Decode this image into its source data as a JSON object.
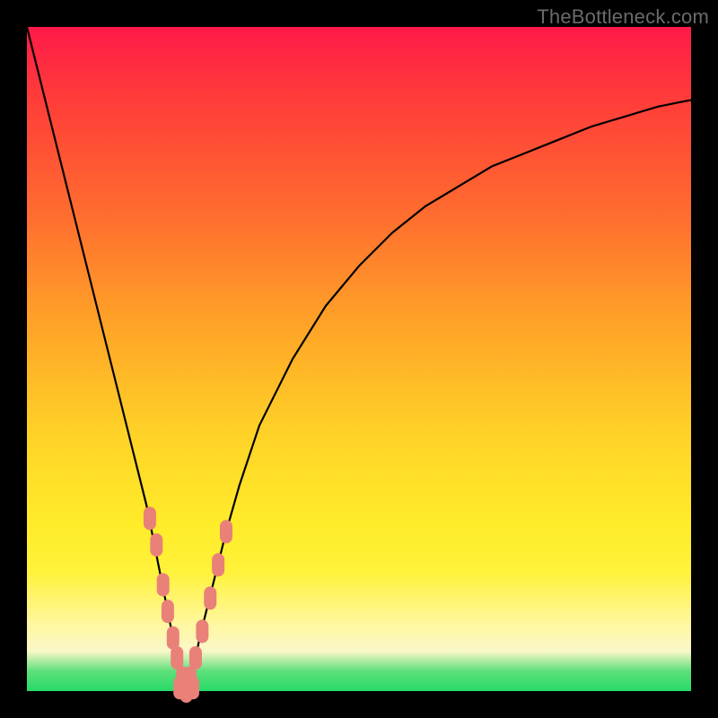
{
  "watermark": "TheBottleneck.com",
  "colors": {
    "frame": "#000000",
    "curve": "#000000",
    "marker": "#e98179",
    "gradient_top": "#ff1a49",
    "gradient_bottom": "#27da68"
  },
  "chart_data": {
    "type": "line",
    "title": "",
    "xlabel": "",
    "ylabel": "",
    "xlim": [
      0,
      100
    ],
    "ylim": [
      0,
      100
    ],
    "x": [
      0,
      2,
      4,
      6,
      8,
      10,
      12,
      14,
      16,
      18,
      20,
      22,
      23,
      24,
      25,
      26,
      28,
      30,
      32,
      35,
      40,
      45,
      50,
      55,
      60,
      65,
      70,
      75,
      80,
      85,
      90,
      95,
      100
    ],
    "y": [
      100,
      92,
      84,
      76,
      68,
      60,
      52,
      44,
      36,
      28,
      18,
      8,
      3,
      0,
      3,
      8,
      16,
      24,
      31,
      40,
      50,
      58,
      64,
      69,
      73,
      76,
      79,
      81,
      83,
      85,
      86.5,
      88,
      89
    ],
    "minimum_x": 24,
    "markers_left": [
      {
        "x": 18.5,
        "y": 26
      },
      {
        "x": 19.5,
        "y": 22
      },
      {
        "x": 20.5,
        "y": 16
      },
      {
        "x": 21.2,
        "y": 12
      },
      {
        "x": 22.0,
        "y": 8
      },
      {
        "x": 22.6,
        "y": 5
      },
      {
        "x": 23.4,
        "y": 2
      }
    ],
    "markers_right": [
      {
        "x": 24.6,
        "y": 2
      },
      {
        "x": 25.4,
        "y": 5
      },
      {
        "x": 26.4,
        "y": 9
      },
      {
        "x": 27.6,
        "y": 14
      },
      {
        "x": 28.8,
        "y": 19
      },
      {
        "x": 30.0,
        "y": 24
      }
    ],
    "markers_bottom": [
      {
        "x": 23.0,
        "y": 0.5
      },
      {
        "x": 24.0,
        "y": 0.0
      },
      {
        "x": 25.0,
        "y": 0.5
      }
    ]
  }
}
